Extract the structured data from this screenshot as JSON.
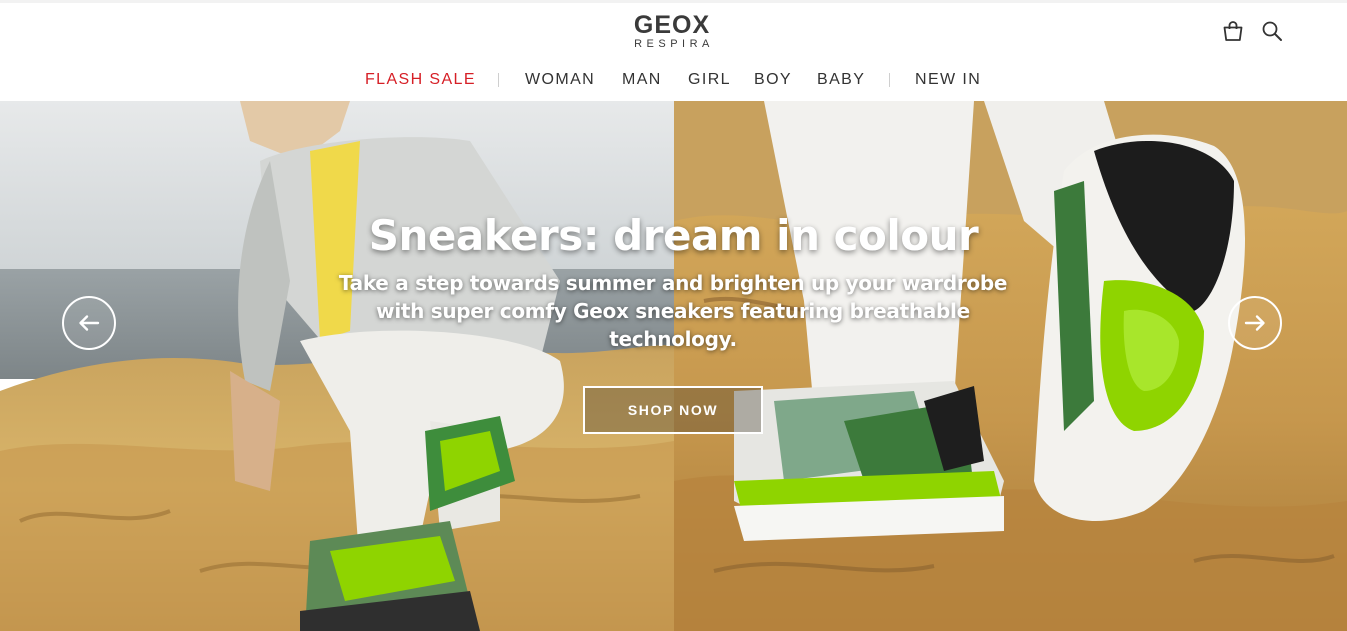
{
  "brand": {
    "name": "GEOX",
    "tagline": "RESPIRA"
  },
  "header": {
    "cart_icon": "shopping-bag-icon",
    "search_icon": "search-icon"
  },
  "nav": {
    "items": [
      {
        "label": "FLASH SALE",
        "highlight": true
      },
      {
        "label": "WOMAN"
      },
      {
        "label": "MAN"
      },
      {
        "label": "GIRL"
      },
      {
        "label": "BOY"
      },
      {
        "label": "BABY"
      },
      {
        "label": "NEW IN"
      }
    ],
    "sale_color": "#d61f26"
  },
  "hero": {
    "title": "Sneakers: dream in colour",
    "text": "Take a step towards summer and brighten up your wardrobe with super comfy Geox sneakers featuring breathable technology.",
    "cta": "SHOP NOW",
    "prev_icon": "arrow-left-icon",
    "next_icon": "arrow-right-icon",
    "accent_color": "#8fd400"
  }
}
